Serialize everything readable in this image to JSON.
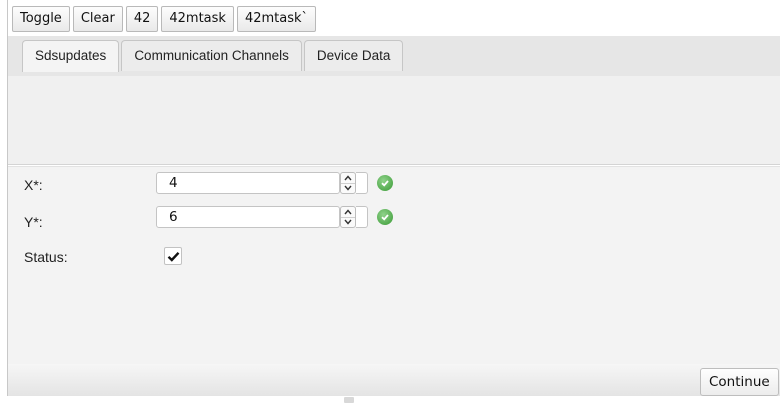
{
  "toolbar": {
    "buttons": [
      "Toggle",
      "Clear",
      "42",
      "42mtask",
      "42mtask`"
    ]
  },
  "tabs": [
    {
      "label": "Sdsupdates",
      "active": true
    },
    {
      "label": "Communication Channels",
      "active": false
    },
    {
      "label": "Device Data",
      "active": false
    }
  ],
  "form": {
    "x": {
      "label": "X*:",
      "value": "4",
      "valid": true
    },
    "y": {
      "label": "Y*:",
      "value": "6",
      "valid": true
    },
    "status": {
      "label": "Status:",
      "checked": true
    }
  },
  "footer": {
    "continue_label": "Continue"
  },
  "colors": {
    "valid_icon": "#3a9a35",
    "tab_bar": "#e6e6e6"
  },
  "icons": {
    "spin_up": "chevron-up-icon",
    "spin_down": "chevron-down-icon",
    "valid": "check-circle-icon",
    "checkbox": "checkmark-icon"
  }
}
